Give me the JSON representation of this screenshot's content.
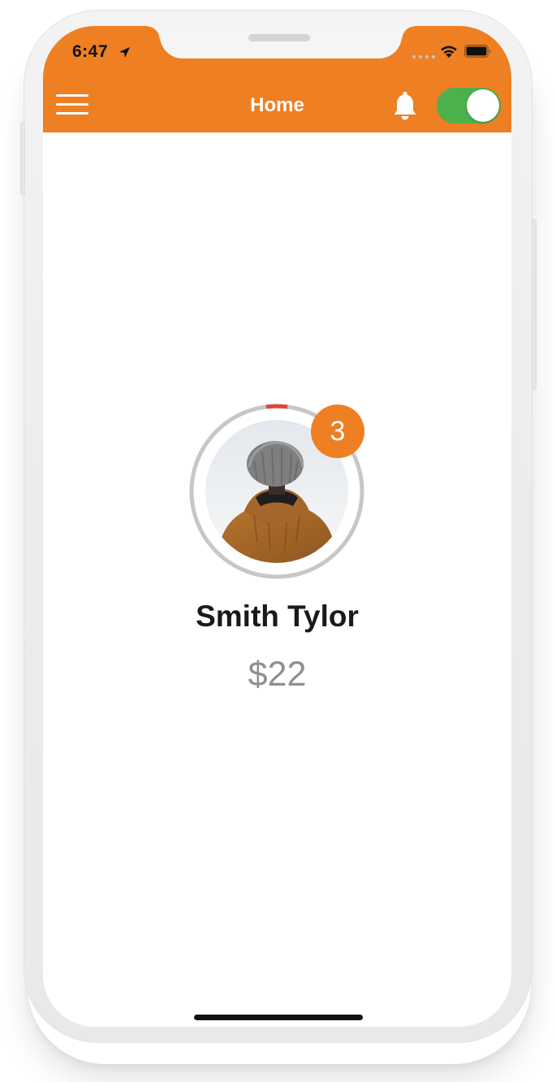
{
  "status_bar": {
    "time": "6:47"
  },
  "header": {
    "title": "Home",
    "menu_icon": "hamburger-menu-icon",
    "notification_icon": "bell-icon",
    "toggle_state": "on"
  },
  "profile": {
    "name": "Smith Tylor",
    "balance": "$22",
    "badge_count": "3",
    "progress_fraction": 0.04
  },
  "colors": {
    "accent": "#EE7F22",
    "toggle_on": "#4CB14D",
    "progress": "#D9463B",
    "ring": "#C7C7C7",
    "name_text": "#1A1A1A",
    "balance_text": "#8F8F8F"
  }
}
